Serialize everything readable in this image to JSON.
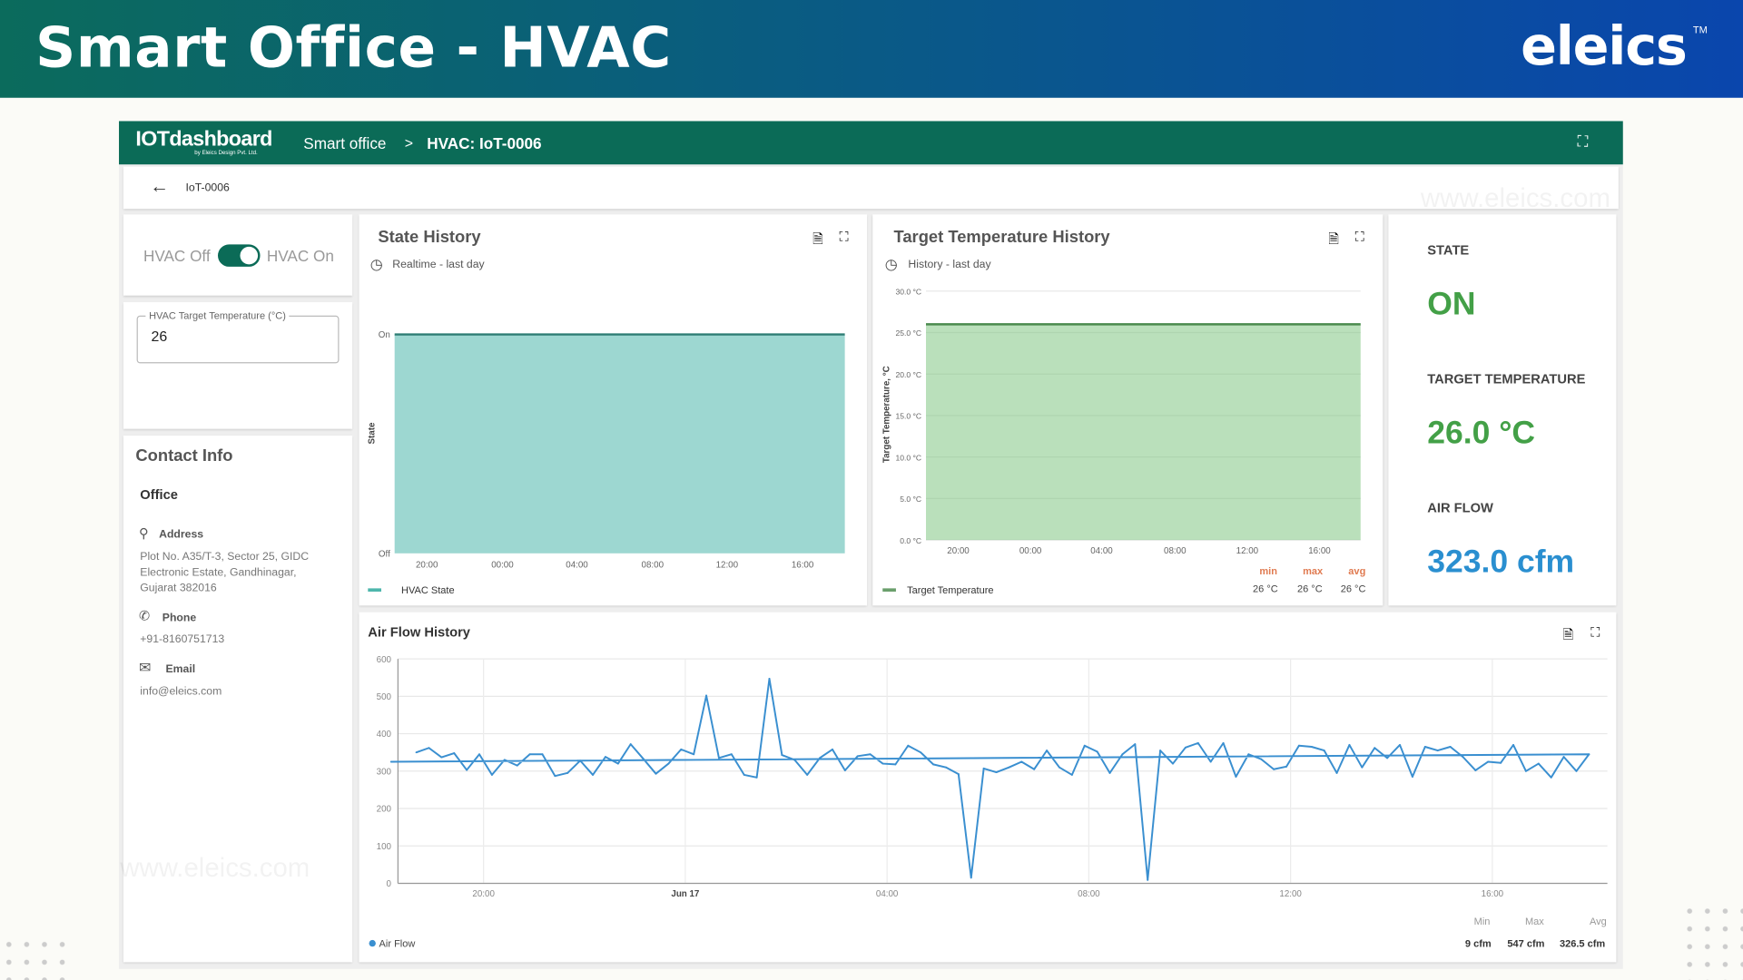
{
  "banner": {
    "title": "Smart Office - HVAC",
    "logo": "eleics",
    "logo_tm": "TM"
  },
  "watermark": "www.eleics.com",
  "topbar": {
    "brand": "IOTdashboard",
    "brand_sub": "by Eleics Design Pvt. Ltd.",
    "crumb1": "Smart office",
    "separator": ">",
    "crumb2": "HVAC: IoT-0006",
    "icon": "fullscreen-exit-icon"
  },
  "subheader": {
    "back_icon": "arrow-left-icon",
    "device": "IoT-0006"
  },
  "toggle": {
    "off_label": "HVAC Off",
    "on_label": "HVAC On",
    "checked": true
  },
  "target_input": {
    "label": "HVAC Target Temperature (°C)",
    "value": "26"
  },
  "contact": {
    "title": "Contact Info",
    "office": "Office",
    "address_label": "Address",
    "address_lines": [
      "Plot No. A35/T-3, Sector 25, GIDC",
      "Electronic Estate, Gandhinagar,",
      "Gujarat 382016"
    ],
    "phone_label": "Phone",
    "phone": "+91-8160751713",
    "email_label": "Email",
    "email": "info@eleics.com"
  },
  "stats": {
    "state_label": "STATE",
    "state_value": "ON",
    "target_label": "TARGET TEMPERATURE",
    "target_value": "26.0 °C",
    "airflow_label": "AIR FLOW",
    "airflow_value": "323.0 cfm",
    "colors": {
      "state": "#43a047",
      "target": "#43a047",
      "airflow": "#2a8fd0"
    }
  },
  "chart_data": [
    {
      "type": "area",
      "title": "State History",
      "subtitle": "Realtime - last day",
      "ylabel": "State",
      "y_ticks": [
        "Off",
        "On"
      ],
      "x_ticks": [
        "20:00",
        "00:00",
        "04:00",
        "08:00",
        "12:00",
        "16:00"
      ],
      "series": [
        {
          "name": "HVAC State",
          "value": "On",
          "color": "#4db6ac"
        }
      ]
    },
    {
      "type": "area",
      "title": "Target Temperature History",
      "subtitle": "History - last day",
      "ylabel": "Target Temperature, °C",
      "ylim": [
        0,
        30
      ],
      "y_ticks": [
        "0.0 °C",
        "5.0 °C",
        "10.0 °C",
        "15.0 °C",
        "20.0 °C",
        "25.0 °C",
        "30.0 °C"
      ],
      "x_ticks": [
        "20:00",
        "00:00",
        "04:00",
        "08:00",
        "12:00",
        "16:00"
      ],
      "series": [
        {
          "name": "Target Temperature",
          "value": 26,
          "color": "#81c784"
        }
      ],
      "summary": {
        "min_label": "min",
        "max_label": "max",
        "avg_label": "avg",
        "min": "26 °C",
        "max": "26 °C",
        "avg": "26 °C"
      }
    },
    {
      "type": "line",
      "title": "Air Flow History",
      "ylim": [
        0,
        600
      ],
      "y_ticks": [
        "0",
        "100",
        "200",
        "300",
        "400",
        "500",
        "600"
      ],
      "x_ticks": [
        "20:00",
        "Jun 17",
        "04:00",
        "08:00",
        "12:00",
        "16:00"
      ],
      "grid": true,
      "series": [
        {
          "name": "Air Flow",
          "color": "#3a8fd0",
          "x": [
            "18:40",
            "18:55",
            "19:10",
            "19:25",
            "19:40",
            "19:55",
            "20:10",
            "20:25",
            "20:40",
            "20:55",
            "21:10",
            "21:25",
            "21:40",
            "21:55",
            "22:10",
            "22:25",
            "22:40",
            "22:55",
            "23:10",
            "23:25",
            "23:40",
            "23:55",
            "00:10",
            "00:25",
            "00:40",
            "00:55",
            "01:10",
            "01:25",
            "01:40",
            "01:55",
            "02:10",
            "02:25",
            "02:40",
            "02:55",
            "03:10",
            "03:25",
            "03:40",
            "03:55",
            "04:10",
            "04:25",
            "04:40",
            "04:55",
            "05:10",
            "05:25",
            "05:40",
            "05:55",
            "06:10",
            "06:25",
            "06:40",
            "06:55",
            "07:10",
            "07:25",
            "07:40",
            "07:55",
            "08:10",
            "08:25",
            "08:40",
            "08:55",
            "09:10",
            "09:25",
            "09:40",
            "09:55",
            "10:10",
            "10:25",
            "10:40",
            "10:55",
            "11:10",
            "11:25",
            "11:40",
            "11:55",
            "12:10",
            "12:25",
            "12:40",
            "12:55",
            "13:10",
            "13:25",
            "13:40",
            "13:55",
            "14:10",
            "14:25",
            "14:40",
            "14:55",
            "15:10",
            "15:25",
            "15:40",
            "15:55",
            "16:10",
            "16:25",
            "16:40",
            "16:55",
            "17:10",
            "17:25",
            "17:40",
            "17:55",
            "18:10"
          ],
          "values": [
            350,
            362,
            337,
            348,
            303,
            345,
            290,
            330,
            315,
            345,
            345,
            287,
            295,
            328,
            290,
            338,
            320,
            372,
            333,
            293,
            320,
            358,
            345,
            502,
            335,
            345,
            290,
            283,
            547,
            343,
            330,
            290,
            335,
            358,
            302,
            340,
            345,
            320,
            318,
            368,
            350,
            318,
            310,
            292,
            15,
            307,
            297,
            310,
            325,
            305,
            355,
            310,
            290,
            368,
            352,
            295,
            345,
            372,
            9,
            355,
            320,
            363,
            375,
            325,
            375,
            285,
            345,
            332,
            305,
            312,
            368,
            365,
            355,
            295,
            370,
            310,
            362,
            335,
            370,
            285,
            365,
            355,
            365,
            338,
            302,
            325,
            322,
            370,
            300,
            320,
            283,
            338,
            300,
            345,
            325
          ]
        }
      ],
      "summary": {
        "min_label": "Min",
        "max_label": "Max",
        "avg_label": "Avg",
        "min": "9 cfm",
        "max": "547 cfm",
        "avg": "326.5 cfm"
      }
    }
  ]
}
